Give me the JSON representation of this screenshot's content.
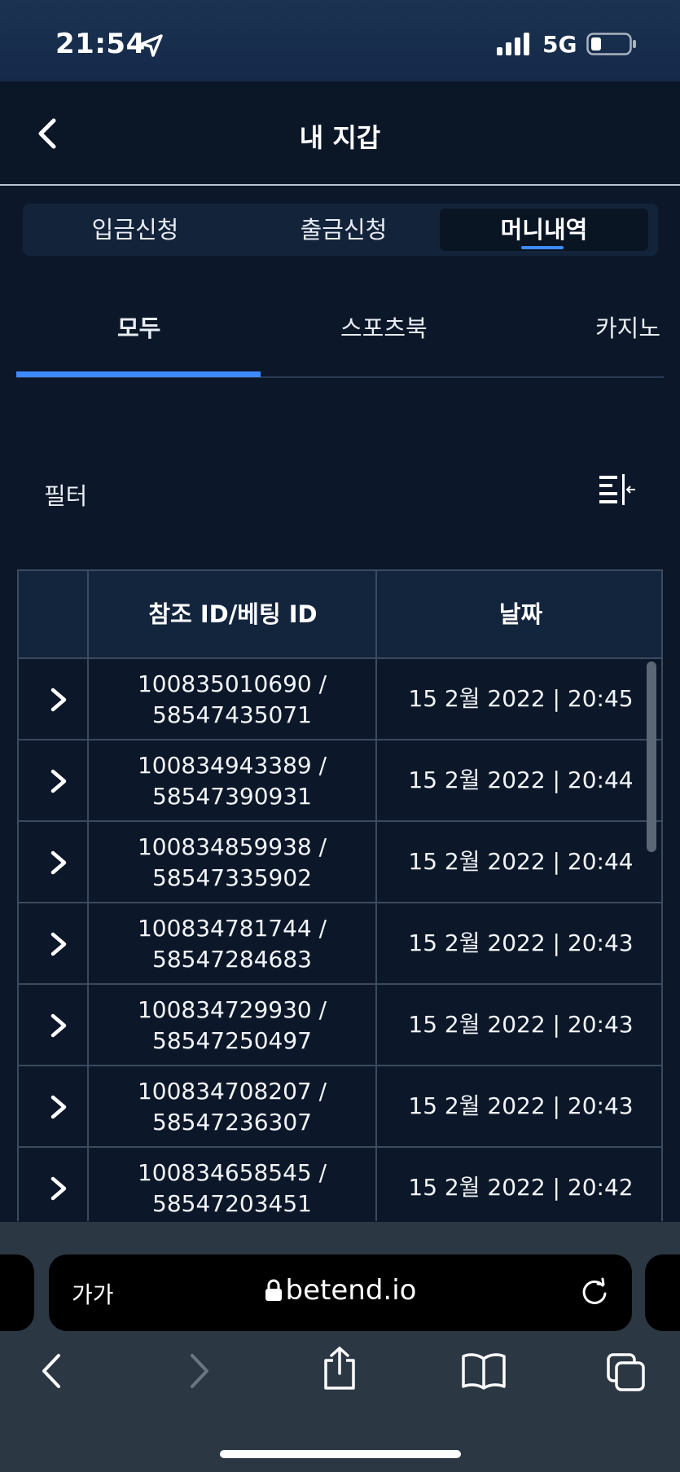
{
  "status_bar": {
    "time": "21:54",
    "network": "5G"
  },
  "header": {
    "title": "내 지갑"
  },
  "segments": [
    {
      "label": "입금신청",
      "active": false
    },
    {
      "label": "출금신청",
      "active": false
    },
    {
      "label": "머니내역",
      "active": true
    }
  ],
  "tabs": [
    {
      "label": "모두",
      "active": true
    },
    {
      "label": "스포츠북",
      "active": false
    },
    {
      "label": "카지노",
      "active": false
    }
  ],
  "filter": {
    "label": "필터"
  },
  "table": {
    "columns": [
      "",
      "참조 ID/베팅 ID",
      "날짜"
    ],
    "rows": [
      {
        "ref": "100835010690 /",
        "bet": "58547435071",
        "date": "15 2월 2022 | 20:45"
      },
      {
        "ref": "100834943389 /",
        "bet": "58547390931",
        "date": "15 2월 2022 | 20:44"
      },
      {
        "ref": "100834859938 /",
        "bet": "58547335902",
        "date": "15 2월 2022 | 20:44"
      },
      {
        "ref": "100834781744 /",
        "bet": "58547284683",
        "date": "15 2월 2022 | 20:43"
      },
      {
        "ref": "100834729930 /",
        "bet": "58547250497",
        "date": "15 2월 2022 | 20:43"
      },
      {
        "ref": "100834708207 /",
        "bet": "58547236307",
        "date": "15 2월 2022 | 20:43"
      },
      {
        "ref": "100834658545 /",
        "bet": "58547203451",
        "date": "15 2월 2022 | 20:42"
      }
    ]
  },
  "browser": {
    "text_size_label": "가가",
    "url": "betend.io"
  },
  "colors": {
    "background": "#0c1829",
    "accent": "#3d8bff",
    "header": "#13243d",
    "border": "#3b4a60"
  }
}
